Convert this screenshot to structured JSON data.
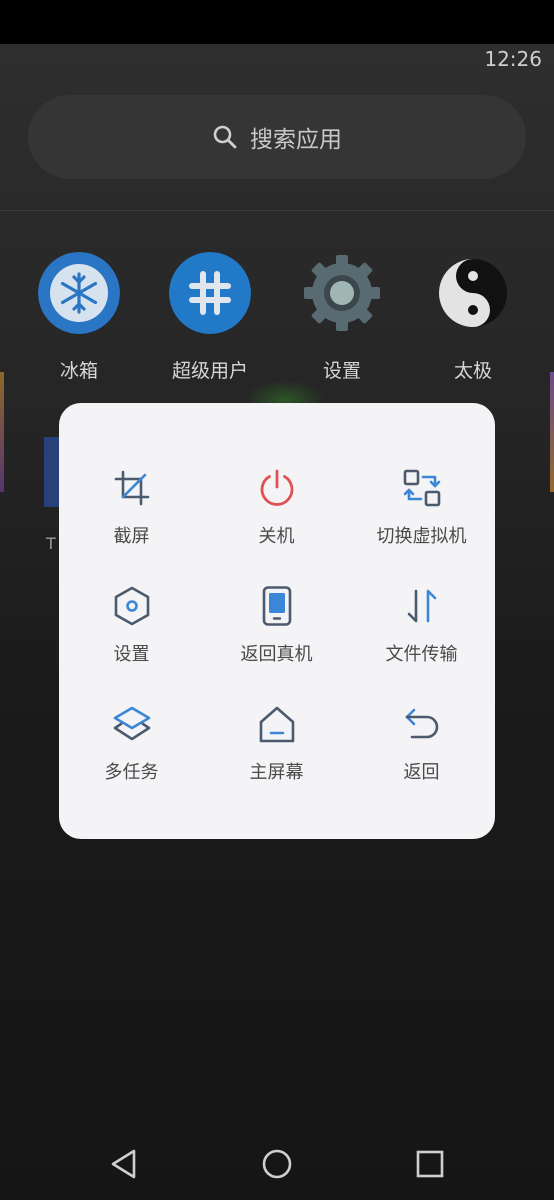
{
  "status_bar": {
    "time": "12:26"
  },
  "search": {
    "placeholder": "搜索应用"
  },
  "apps": [
    {
      "label": "冰箱",
      "icon": "snowflake-icon"
    },
    {
      "label": "超级用户",
      "icon": "hash-icon"
    },
    {
      "label": "设置",
      "icon": "gear-icon"
    },
    {
      "label": "太极",
      "icon": "yin-yang-icon"
    }
  ],
  "background": {
    "partial_letter": "T"
  },
  "menu": {
    "items": [
      {
        "label": "截屏",
        "icon": "crop-icon"
      },
      {
        "label": "关机",
        "icon": "power-icon"
      },
      {
        "label": "切换虚拟机",
        "icon": "switch-vm-icon"
      },
      {
        "label": "设置",
        "icon": "hexagon-settings-icon"
      },
      {
        "label": "返回真机",
        "icon": "phone-icon"
      },
      {
        "label": "文件传输",
        "icon": "transfer-arrows-icon"
      },
      {
        "label": "多任务",
        "icon": "layers-icon"
      },
      {
        "label": "主屏幕",
        "icon": "home-icon"
      },
      {
        "label": "返回",
        "icon": "undo-arrow-icon"
      }
    ]
  },
  "nav": {
    "back": "back-triangle-icon",
    "home": "home-circle-icon",
    "recents": "recents-square-icon"
  },
  "colors": {
    "accent_blue": "#3b86d6",
    "power_red": "#e05151",
    "icon_dark": "#4b5a6d"
  }
}
